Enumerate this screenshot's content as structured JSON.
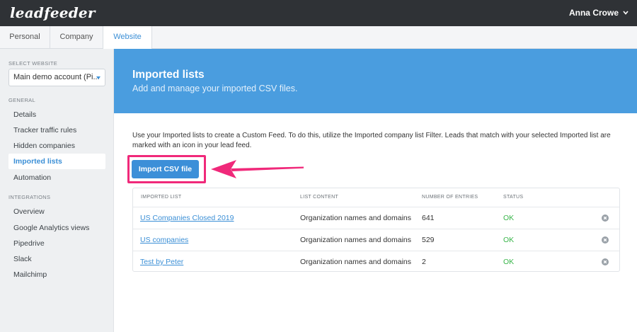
{
  "app": {
    "logo": "leadfeeder",
    "user_name": "Anna Crowe"
  },
  "tabs": [
    {
      "label": "Personal"
    },
    {
      "label": "Company"
    },
    {
      "label": "Website"
    }
  ],
  "sidebar": {
    "select_website_label": "SELECT WEBSITE",
    "selected_website": "Main demo account (Pi...",
    "general_label": "GENERAL",
    "general_items": [
      {
        "label": "Details"
      },
      {
        "label": "Tracker traffic rules"
      },
      {
        "label": "Hidden companies"
      },
      {
        "label": "Imported lists"
      },
      {
        "label": "Automation"
      }
    ],
    "integrations_label": "INTEGRATIONS",
    "integration_items": [
      {
        "label": "Overview"
      },
      {
        "label": "Google Analytics views"
      },
      {
        "label": "Pipedrive"
      },
      {
        "label": "Slack"
      },
      {
        "label": "Mailchimp"
      }
    ]
  },
  "banner": {
    "title": "Imported lists",
    "subtitle": "Add and manage your imported CSV files."
  },
  "description": "Use your Imported lists to create a Custom Feed. To do this, utilize the Imported company list Filter. Leads that match with your selected Imported list are marked with an icon in your lead feed.",
  "import_button_label": "Import CSV file",
  "table": {
    "headers": [
      "IMPORTED LIST",
      "LIST CONTENT",
      "NUMBER OF ENTRIES",
      "STATUS"
    ],
    "rows": [
      {
        "name": "US Companies Closed 2019",
        "content": "Organization names and domains",
        "entries": "641",
        "status": "OK"
      },
      {
        "name": "US companies",
        "content": "Organization names and domains",
        "entries": "529",
        "status": "OK"
      },
      {
        "name": "Test by Peter",
        "content": "Organization names and domains",
        "entries": "2",
        "status": "OK"
      }
    ]
  },
  "colors": {
    "topbar": "#2f3236",
    "accent": "#3b8fd6",
    "banner": "#4a9ddf",
    "highlight": "#f0297a",
    "status_ok": "#39b54a"
  },
  "icons": {
    "user_menu": "chevron-down-icon",
    "select": "caret-down-icon",
    "row_remove": "remove-circle-icon",
    "callout": "arrow-left-icon"
  }
}
